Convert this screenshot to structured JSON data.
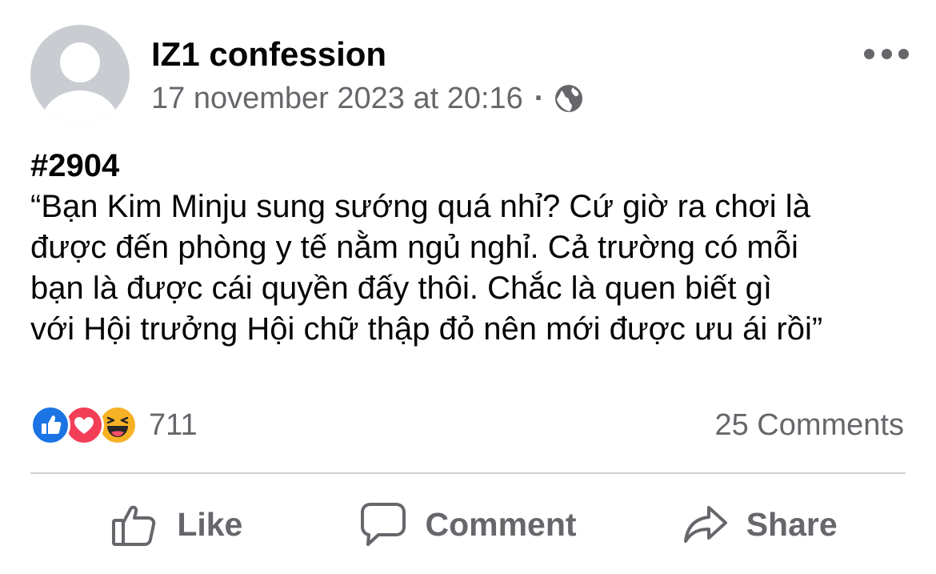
{
  "post": {
    "page_name": "IZ1 confession",
    "timestamp": "17 november 2023 at 20:16",
    "separator": "·",
    "privacy_icon": "globe-icon",
    "tag": "#2904",
    "body_lines": [
      "“Bạn Kim Minju sung sướng quá nhỉ? Cứ giờ ra chơi là",
      "được đến phòng y tế nằm ngủ nghỉ. Cả trường có mỗi",
      "bạn là được cái quyền đấy thôi. Chắc là quen biết gì",
      "với Hội trưởng Hội chữ thập đỏ nên mới được ưu ái rồi”"
    ]
  },
  "stats": {
    "reaction_icons": [
      "like-icon",
      "love-icon",
      "haha-icon"
    ],
    "reaction_count": "711",
    "comments": "25 Comments"
  },
  "actions": {
    "like": "Like",
    "comment": "Comment",
    "share": "Share"
  },
  "colors": {
    "primary_text": "#050505",
    "secondary_text": "#65676b",
    "like_blue": "#1b74e4",
    "love_red": "#f33e58",
    "haha_yellow": "#f7b125",
    "avatar_gray": "#c9ccd1",
    "divider": "#ced0d4"
  }
}
